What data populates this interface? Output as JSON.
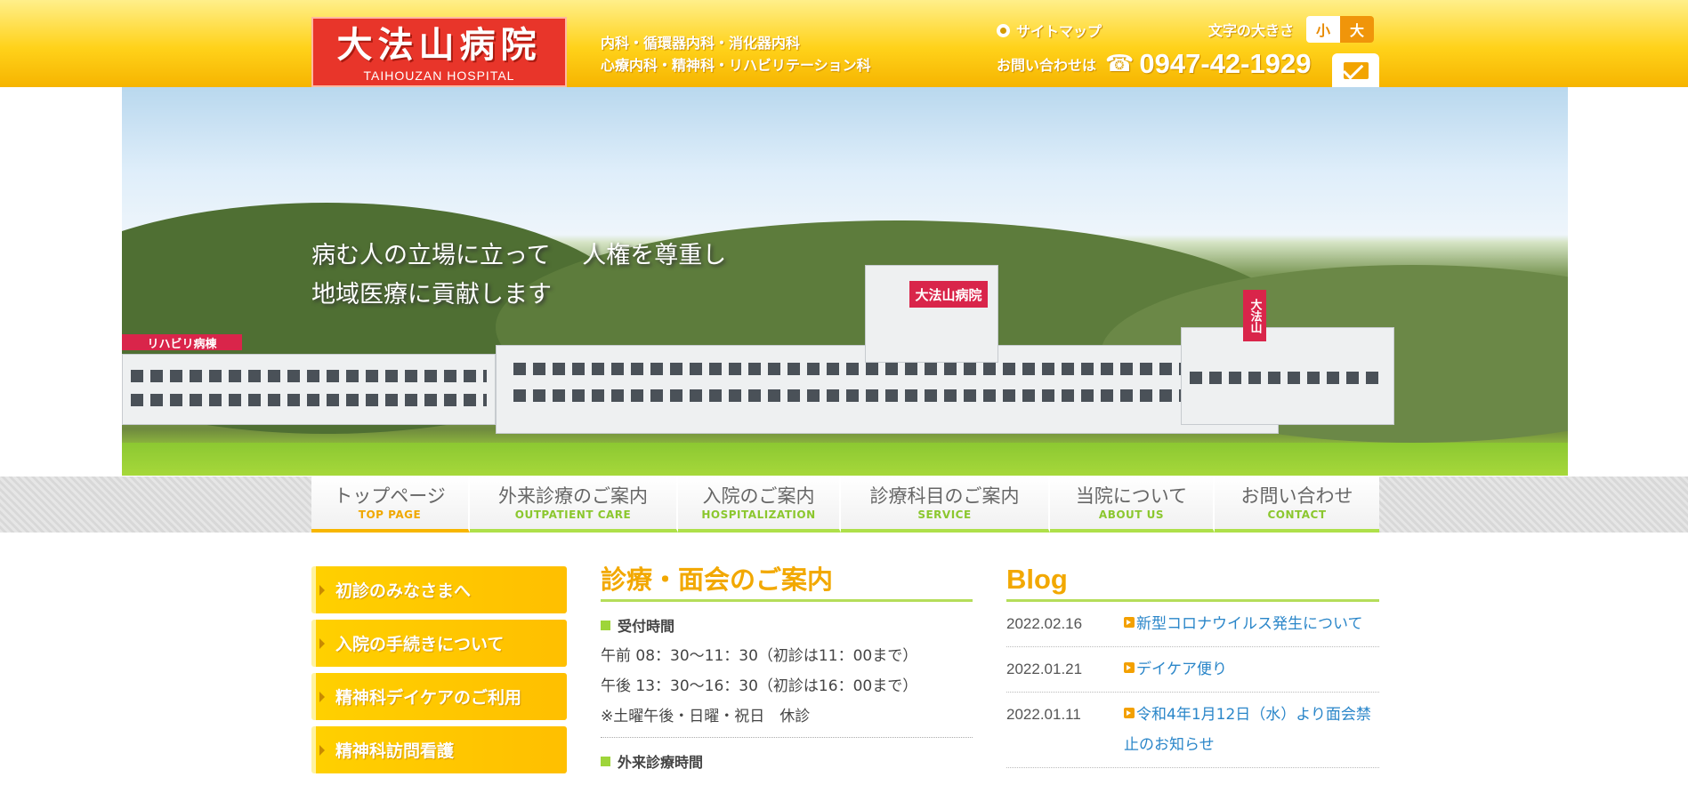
{
  "header": {
    "logo_main": "大法山病院",
    "logo_sub": "TAIHOUZAN HOSPITAL",
    "departments_line1": "内科・循環器内科・消化器内科",
    "departments_line2": "心療内科・精神科・リハビリテーション科",
    "sitemap_label": "サイトマップ",
    "font_size_label": "文字の大きさ",
    "font_small": "小",
    "font_large": "大",
    "contact_label": "お問い合わせは",
    "phone_icon": "☎",
    "phone": "0947-42-1929",
    "mail_icon": "mail-icon"
  },
  "hero": {
    "caption_line1": "病む人の立場に立って　 人権を尊重し",
    "caption_line2": "地域医療に貢献します",
    "sign_main": "大法山病院",
    "sign_left": "リハビリ病棟",
    "sign_tower": "大法山"
  },
  "nav": {
    "items": [
      {
        "jp": "トップページ",
        "en": "TOP PAGE"
      },
      {
        "jp": "外来診療のご案内",
        "en": "OUTPATIENT CARE"
      },
      {
        "jp": "入院のご案内",
        "en": "HOSPITALIZATION"
      },
      {
        "jp": "診療科目のご案内",
        "en": "SERVICE"
      },
      {
        "jp": "当院について",
        "en": "ABOUT US"
      },
      {
        "jp": "お問い合わせ",
        "en": "CONTACT"
      }
    ]
  },
  "sidebar": {
    "items": [
      {
        "label": "初診のみなさまへ"
      },
      {
        "label": "入院の手続きについて"
      },
      {
        "label": "精神科デイケアのご利用"
      },
      {
        "label": "精神科訪問看護"
      }
    ]
  },
  "info": {
    "title": "診療・面会のご案内",
    "reception_head": "受付時間",
    "hours_am": "午前 08：30～11：30（初診は11：00まで）",
    "hours_pm": "午後 13：30～16：30（初診は16：00まで）",
    "closed": "※土曜午後・日曜・祝日　休診",
    "outpatient_head": "外来診療時間"
  },
  "blog": {
    "title": "Blog",
    "posts": [
      {
        "date": "2022.02.16",
        "title": "新型コロナウイルス発生について"
      },
      {
        "date": "2022.01.21",
        "title": "デイケア便り"
      },
      {
        "date": "2022.01.11",
        "title": "令和4年1月12日（水）より面会禁止のお知らせ"
      }
    ]
  }
}
